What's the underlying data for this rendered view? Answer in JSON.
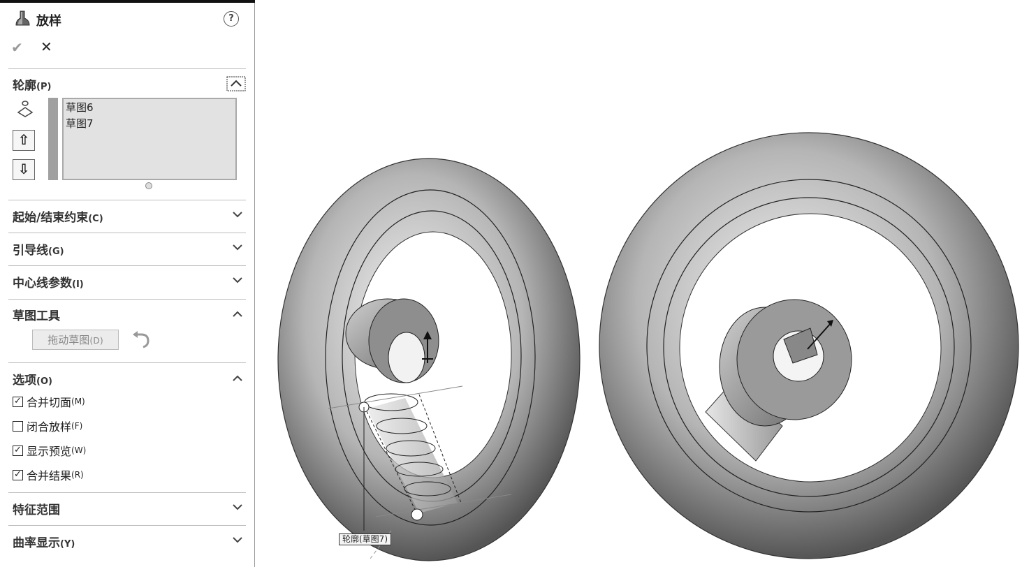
{
  "header": {
    "title": "放样",
    "help": "?"
  },
  "actions": {
    "ok": "✔",
    "cancel": "✕"
  },
  "profile": {
    "label": "轮廓",
    "shortcut": "(P)",
    "items": [
      "草图6",
      "草图7"
    ],
    "up_arrow": "⇧",
    "down_arrow": "⇩"
  },
  "sections": {
    "start_end": {
      "label": "起始/结束约束",
      "shortcut": "(C)"
    },
    "guides": {
      "label": "引导线",
      "shortcut": "(G)"
    },
    "centerline": {
      "label": "中心线参数",
      "shortcut": "(I)"
    },
    "sketch_tools": {
      "label": "草图工具",
      "drag_button": "拖动草图",
      "drag_shortcut": "(D)"
    },
    "options": {
      "label": "选项",
      "shortcut": "(O)",
      "items": [
        {
          "label": "合并切面",
          "shortcut": "(M)",
          "checked": true
        },
        {
          "label": "闭合放样",
          "shortcut": "(F)",
          "checked": false
        },
        {
          "label": "显示预览",
          "shortcut": "(W)",
          "checked": true
        },
        {
          "label": "合并结果",
          "shortcut": "(R)",
          "checked": true
        }
      ]
    },
    "feature_scope": {
      "label": "特征范围"
    },
    "curvature": {
      "label": "曲率显示",
      "shortcut": "(Y)"
    }
  },
  "viewport": {
    "callout": "轮廓(草图7)"
  },
  "icons": [
    "loft-icon",
    "help-icon",
    "check-icon",
    "close-icon",
    "profile-icon",
    "undo-icon"
  ]
}
